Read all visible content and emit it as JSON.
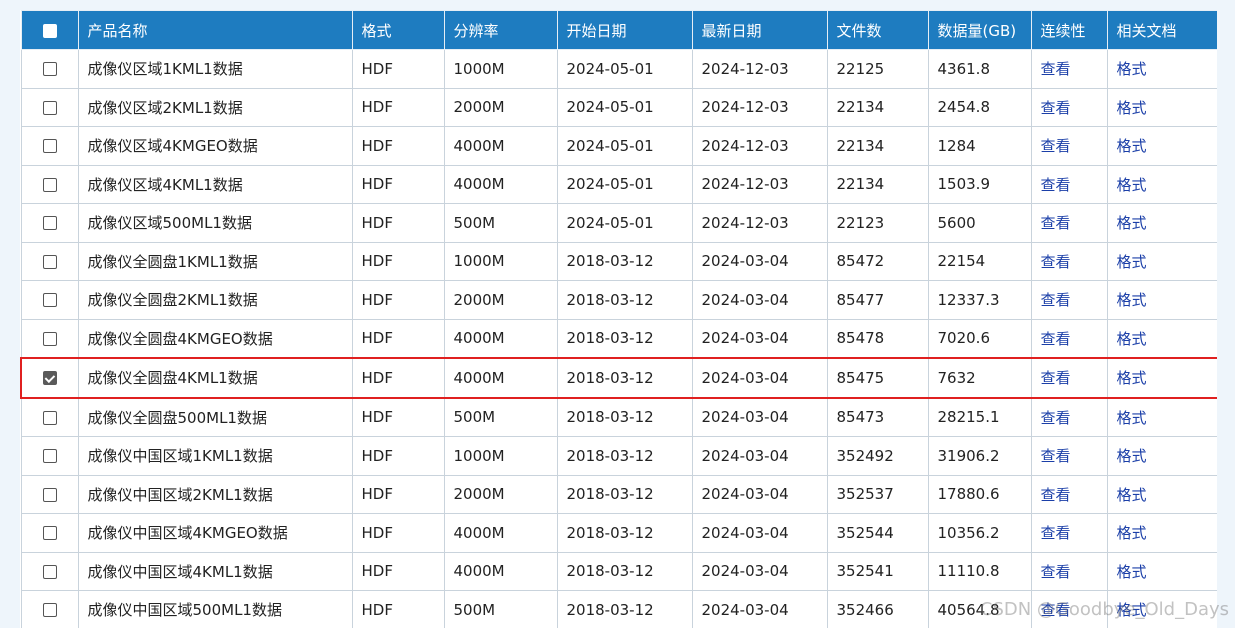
{
  "table": {
    "columns": [
      "产品名称",
      "格式",
      "分辨率",
      "开始日期",
      "最新日期",
      "文件数",
      "数据量(GB)",
      "连续性",
      "相关文档"
    ],
    "view_label": "查看",
    "format_label": "格式",
    "rows": [
      {
        "checked": false,
        "name": "成像仪区域1KML1数据",
        "format": "HDF",
        "resolution": "1000M",
        "start": "2024-05-01",
        "latest": "2024-12-03",
        "files": "22125",
        "size": "4361.8"
      },
      {
        "checked": false,
        "name": "成像仪区域2KML1数据",
        "format": "HDF",
        "resolution": "2000M",
        "start": "2024-05-01",
        "latest": "2024-12-03",
        "files": "22134",
        "size": "2454.8"
      },
      {
        "checked": false,
        "name": "成像仪区域4KMGEO数据",
        "format": "HDF",
        "resolution": "4000M",
        "start": "2024-05-01",
        "latest": "2024-12-03",
        "files": "22134",
        "size": "1284"
      },
      {
        "checked": false,
        "name": "成像仪区域4KML1数据",
        "format": "HDF",
        "resolution": "4000M",
        "start": "2024-05-01",
        "latest": "2024-12-03",
        "files": "22134",
        "size": "1503.9"
      },
      {
        "checked": false,
        "name": "成像仪区域500ML1数据",
        "format": "HDF",
        "resolution": "500M",
        "start": "2024-05-01",
        "latest": "2024-12-03",
        "files": "22123",
        "size": "5600"
      },
      {
        "checked": false,
        "name": "成像仪全圆盘1KML1数据",
        "format": "HDF",
        "resolution": "1000M",
        "start": "2018-03-12",
        "latest": "2024-03-04",
        "files": "85472",
        "size": "22154"
      },
      {
        "checked": false,
        "name": "成像仪全圆盘2KML1数据",
        "format": "HDF",
        "resolution": "2000M",
        "start": "2018-03-12",
        "latest": "2024-03-04",
        "files": "85477",
        "size": "12337.3"
      },
      {
        "checked": false,
        "name": "成像仪全圆盘4KMGEO数据",
        "format": "HDF",
        "resolution": "4000M",
        "start": "2018-03-12",
        "latest": "2024-03-04",
        "files": "85478",
        "size": "7020.6"
      },
      {
        "checked": true,
        "name": "成像仪全圆盘4KML1数据",
        "format": "HDF",
        "resolution": "4000M",
        "start": "2018-03-12",
        "latest": "2024-03-04",
        "files": "85475",
        "size": "7632"
      },
      {
        "checked": false,
        "name": "成像仪全圆盘500ML1数据",
        "format": "HDF",
        "resolution": "500M",
        "start": "2018-03-12",
        "latest": "2024-03-04",
        "files": "85473",
        "size": "28215.1"
      },
      {
        "checked": false,
        "name": "成像仪中国区域1KML1数据",
        "format": "HDF",
        "resolution": "1000M",
        "start": "2018-03-12",
        "latest": "2024-03-04",
        "files": "352492",
        "size": "31906.2"
      },
      {
        "checked": false,
        "name": "成像仪中国区域2KML1数据",
        "format": "HDF",
        "resolution": "2000M",
        "start": "2018-03-12",
        "latest": "2024-03-04",
        "files": "352537",
        "size": "17880.6"
      },
      {
        "checked": false,
        "name": "成像仪中国区域4KMGEO数据",
        "format": "HDF",
        "resolution": "4000M",
        "start": "2018-03-12",
        "latest": "2024-03-04",
        "files": "352544",
        "size": "10356.2"
      },
      {
        "checked": false,
        "name": "成像仪中国区域4KML1数据",
        "format": "HDF",
        "resolution": "4000M",
        "start": "2018-03-12",
        "latest": "2024-03-04",
        "files": "352541",
        "size": "11110.8"
      },
      {
        "checked": false,
        "name": "成像仪中国区域500ML1数据",
        "format": "HDF",
        "resolution": "500M",
        "start": "2018-03-12",
        "latest": "2024-03-04",
        "files": "352466",
        "size": "40564.8"
      }
    ]
  },
  "watermark": "CSDN @Goodbye_Old_Days"
}
